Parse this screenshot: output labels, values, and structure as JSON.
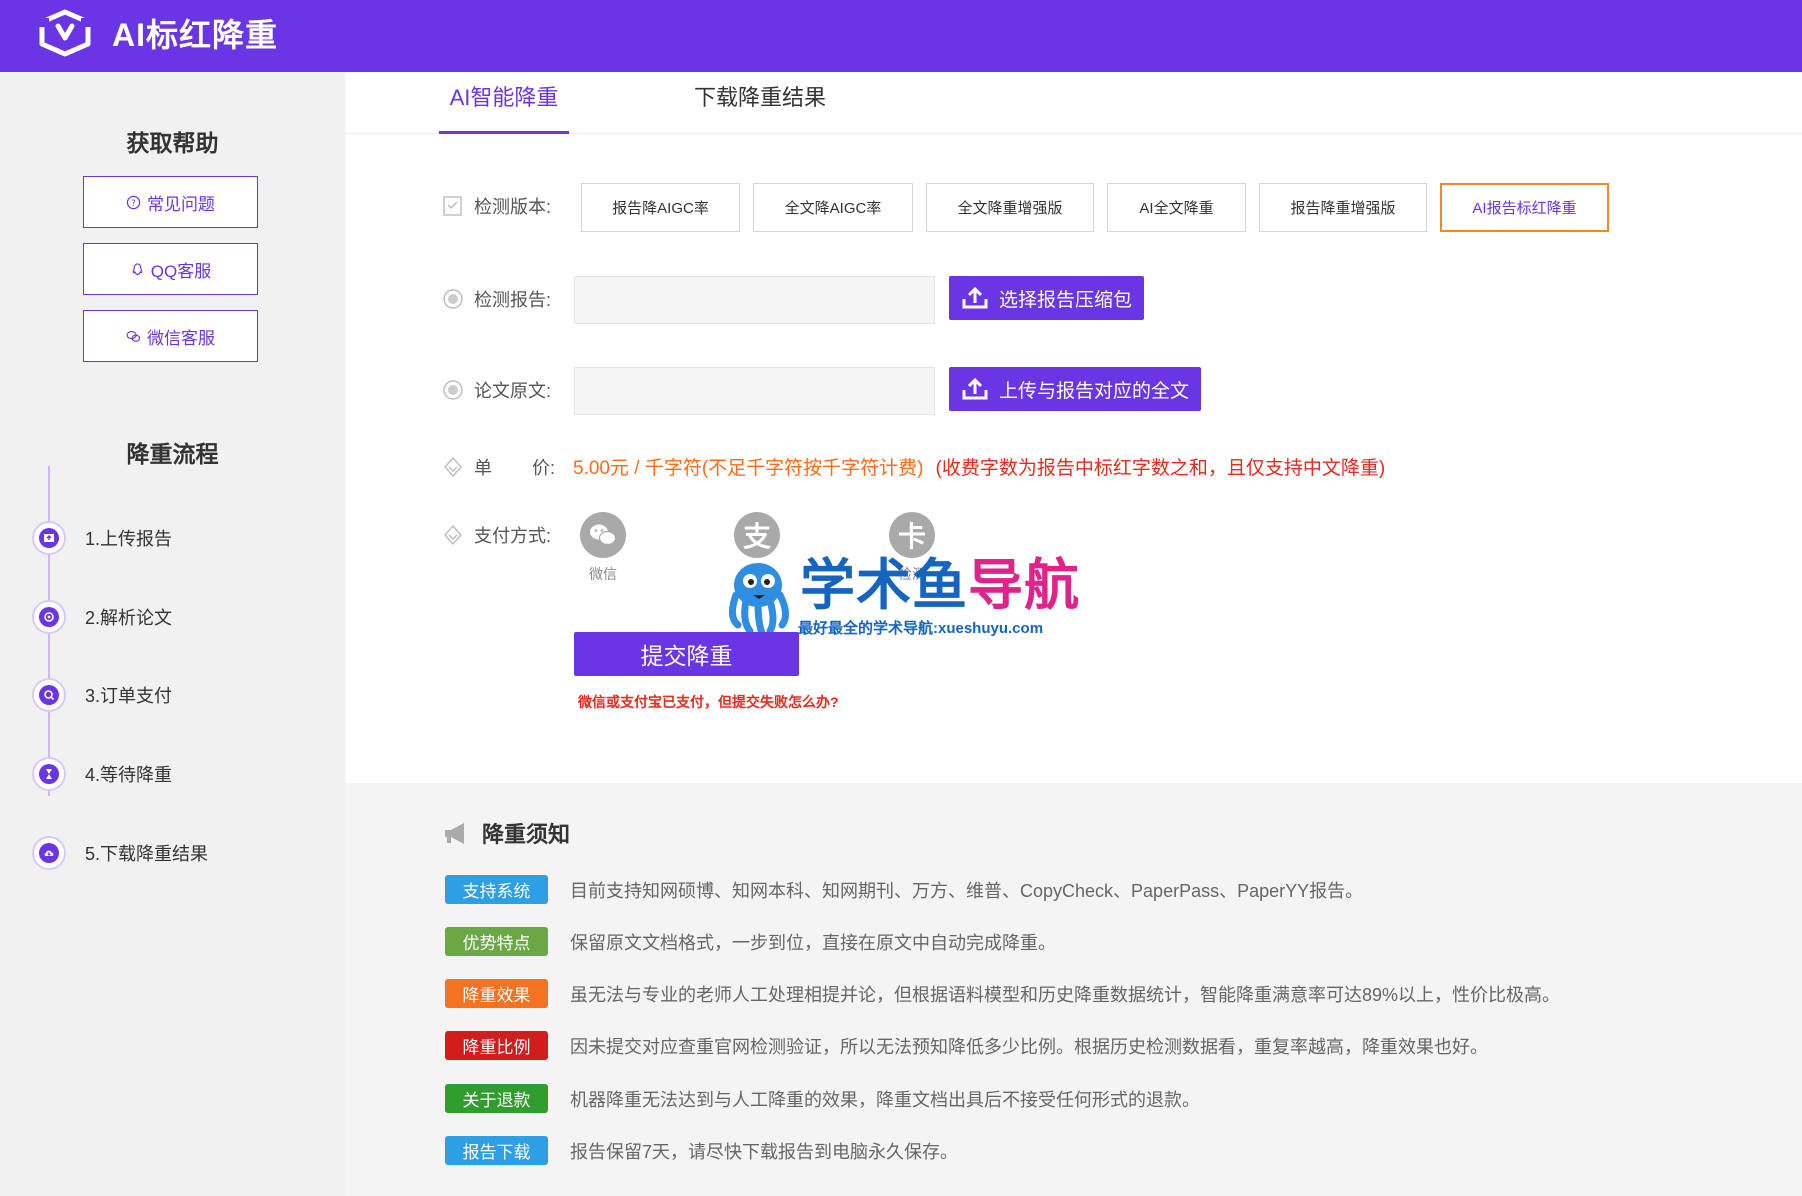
{
  "header": {
    "brand": "AI标红降重"
  },
  "sidebar": {
    "help_title": "获取帮助",
    "help_buttons": [
      {
        "label": "常见问题",
        "icon": "question-circle-icon"
      },
      {
        "label": "QQ客服",
        "icon": "qq-icon"
      },
      {
        "label": "微信客服",
        "icon": "wechat-icon"
      }
    ],
    "process_title": "降重流程",
    "steps": [
      {
        "label": "1.上传报告",
        "icon": "upload-icon"
      },
      {
        "label": "2.解析论文",
        "icon": "analyze-icon"
      },
      {
        "label": "3.订单支付",
        "icon": "payment-icon"
      },
      {
        "label": "4.等待降重",
        "icon": "hourglass-icon"
      },
      {
        "label": "5.下载降重结果",
        "icon": "cloud-download-icon"
      }
    ]
  },
  "tabs": [
    {
      "label": "AI智能降重",
      "active": true
    },
    {
      "label": "下载降重结果",
      "active": false
    }
  ],
  "form": {
    "version_label": "检测版本:",
    "versions": [
      "报告降AIGC率",
      "全文降AIGC率",
      "全文降重增强版",
      "AI全文降重",
      "报告降重增强版",
      "AI报告标红降重"
    ],
    "selected_version": "AI报告标红降重",
    "report_label": "检测报告:",
    "report_button": "选择报告压缩包",
    "paper_label": "论文原文:",
    "paper_button": "上传与报告对应的全文",
    "price_label_1": "单",
    "price_label_2": "价:",
    "price_value": "5.00元 / 千字符(不足千字符按千字符计费)",
    "price_note": "(收费字数为报告中标红字数之和，且仅支持中文降重)",
    "payment_label": "支付方式:",
    "payment_options": [
      {
        "label": "微信",
        "icon": "wechat-pay-icon",
        "glyph": ""
      },
      {
        "label": "",
        "icon": "alipay-icon",
        "glyph": "支"
      },
      {
        "label": "检测",
        "icon": "card-icon",
        "glyph": "卡"
      }
    ],
    "submit": "提交降重",
    "help_link": "微信或支付宝已支付，但提交失败怎么办?"
  },
  "watermark": {
    "title_part1": "学术鱼",
    "title_part2": "导航",
    "subtitle": "最好最全的学术导航:xueshuyu.com"
  },
  "notes": {
    "title": "降重须知",
    "items": [
      {
        "badge": "支持系统",
        "color": "#2d9fe5",
        "text": "目前支持知网硕博、知网本科、知网期刊、万方、维普、CopyCheck、PaperPass、PaperYY报告。"
      },
      {
        "badge": "优势特点",
        "color": "#6aa843",
        "text": "保留原文文档格式，一步到位，直接在原文中自动完成降重。"
      },
      {
        "badge": "降重效果",
        "color": "#f47321",
        "text": "虽无法与专业的老师人工处理相提并论，但根据语料模型和历史降重数据统计，智能降重满意率可达89%以上，性价比极高。"
      },
      {
        "badge": "降重比例",
        "color": "#d31c1c",
        "text": "因未提交对应查重官网检测验证，所以无法预知降低多少比例。根据历史检测数据看，重复率越高，降重效果也好。"
      },
      {
        "badge": "关于退款",
        "color": "#2f9e2c",
        "text": "机器降重无法达到与人工降重的效果，降重文档出具后不接受任何形式的退款。"
      },
      {
        "badge": "报告下载",
        "color": "#2d9fe5",
        "text": "报告保留7天，请尽快下载报告到电脑永久保存。"
      }
    ]
  },
  "colors": {
    "brand": "#6a35e4",
    "price": "#ff6a1a",
    "warning": "#e52b1e",
    "selected_border": "#f08a24"
  }
}
